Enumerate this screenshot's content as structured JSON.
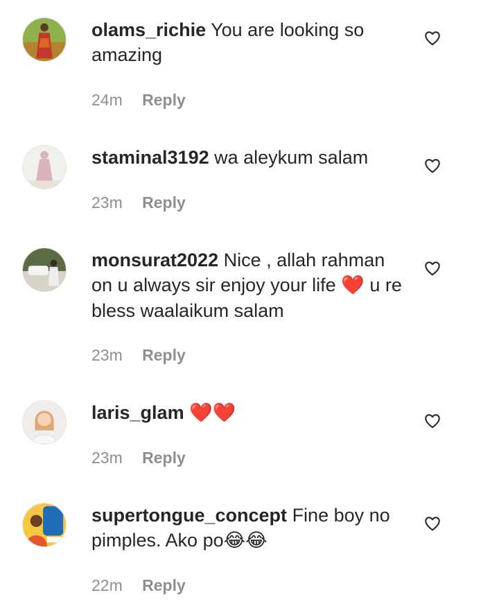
{
  "comments": [
    {
      "username": "olams_richie",
      "text": "You are looking so amazing",
      "time": "24m",
      "reply_label": "Reply",
      "avatar_icon": "user-avatar-icon",
      "avatar_colors": [
        "#7c9a3a",
        "#c0392b"
      ]
    },
    {
      "username": "staminal3192",
      "text": "wa aleykum salam",
      "time": "23m",
      "reply_label": "Reply",
      "avatar_icon": "user-avatar-icon",
      "avatar_colors": [
        "#f2f0ec",
        "#d8b3bd"
      ]
    },
    {
      "username": "monsurat2022",
      "text_before": "Nice , allah rahman on u always sir enjoy your life",
      "emoji": "❤️",
      "text_after": "u re bless waalaikum salam",
      "time": "23m",
      "reply_label": "Reply",
      "avatar_icon": "user-avatar-icon",
      "avatar_colors": [
        "#4a5a3a",
        "#eeeeee"
      ]
    },
    {
      "username": "laris_glam",
      "emoji": "❤️❤️",
      "time": "23m",
      "reply_label": "Reply",
      "avatar_icon": "user-avatar-icon",
      "avatar_colors": [
        "#f1eeea",
        "#e0a878"
      ]
    },
    {
      "username": "supertongue_concept",
      "text": "Fine boy no pimples. Ako po",
      "emoji": "😂😂",
      "time": "22m",
      "reply_label": "Reply",
      "avatar_icon": "user-avatar-icon",
      "avatar_colors": [
        "#1e6db5",
        "#e4572e"
      ]
    }
  ],
  "like_icon": "heart-outline-icon",
  "colors": {
    "text": "#262626",
    "meta": "#8e8e8e",
    "heart": "#e0141e"
  }
}
